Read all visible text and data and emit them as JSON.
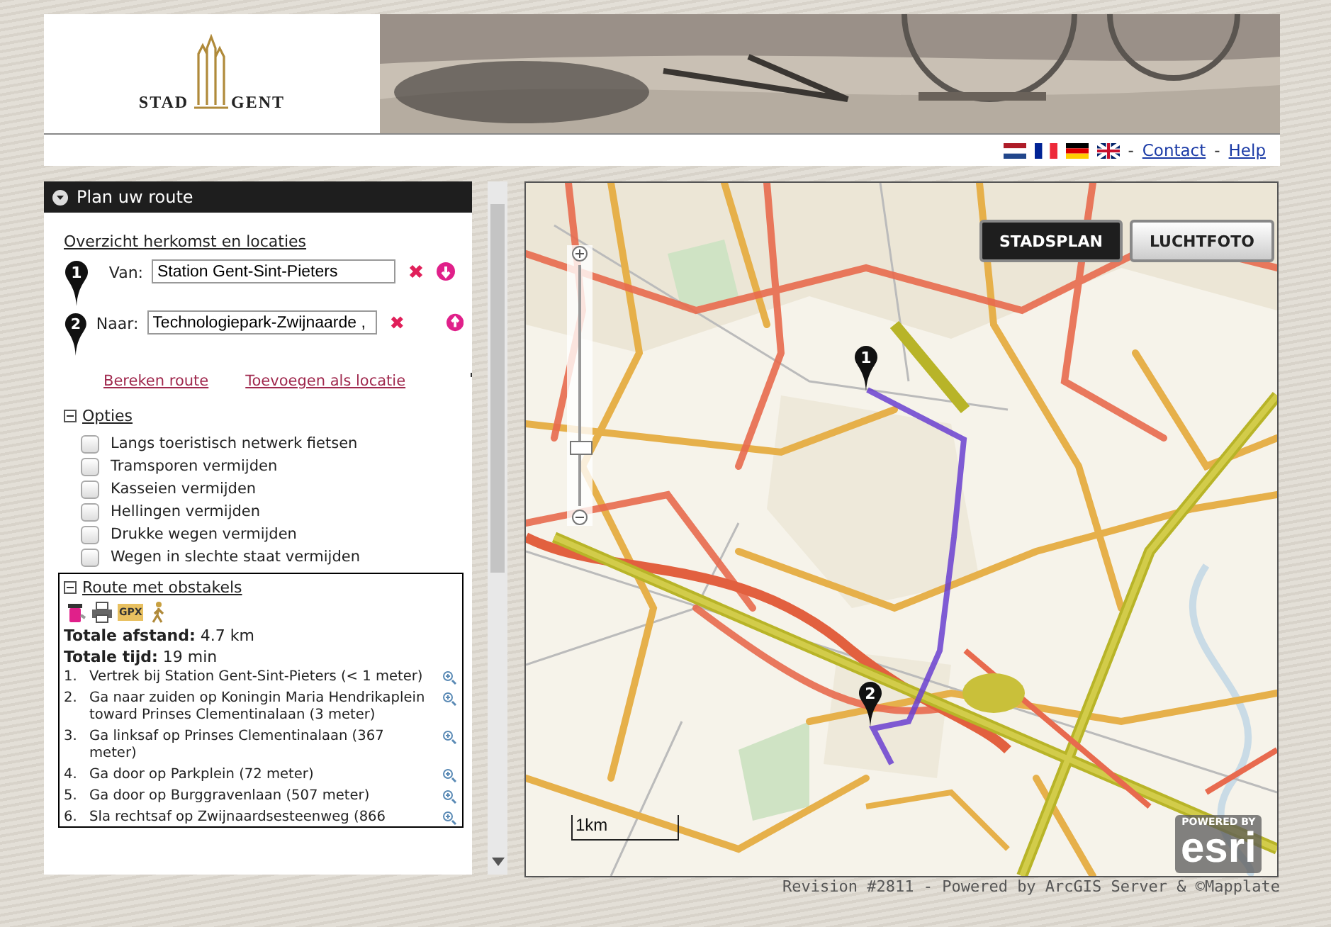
{
  "header": {
    "logo_words": [
      "STAD",
      "GENT"
    ]
  },
  "link_bar": {
    "items": [
      {
        "kind": "separator",
        "text": "-"
      },
      {
        "kind": "link",
        "text": "Contact"
      },
      {
        "kind": "separator",
        "text": "-"
      },
      {
        "kind": "link",
        "text": "Help"
      }
    ]
  },
  "panel": {
    "title": "Plan uw route",
    "expanded": true,
    "overview_link": "Overzicht herkomst en locaties",
    "stops": [
      {
        "number": "1",
        "label": "Van:",
        "value": "Station Gent-Sint-Pieters",
        "move_down": true,
        "move_up": false
      },
      {
        "number": "2",
        "label": "Naar:",
        "value": "Technologiepark-Zwijnaarde ,",
        "move_down": false,
        "move_up": true
      }
    ],
    "actions": [
      "Bereken route",
      "Toevoegen als locatie"
    ],
    "options": {
      "title": "Opties",
      "items": [
        {
          "label": "Langs toeristisch netwerk fietsen",
          "checked": false
        },
        {
          "label": "Tramsporen vermijden",
          "checked": false
        },
        {
          "label": "Kasseien vermijden",
          "checked": false
        },
        {
          "label": "Hellingen vermijden",
          "checked": false
        },
        {
          "label": "Drukke wegen vermijden",
          "checked": false
        },
        {
          "label": "Wegen in slechte staat vermijden",
          "checked": false
        }
      ]
    },
    "route": {
      "title": "Route met obstakels",
      "gpx_label": "GPX",
      "distance_label": "Totale afstand:",
      "distance": "4.7 km",
      "time_label": "Totale tijd:",
      "time": "19 min",
      "steps": [
        {
          "number": "1.",
          "text": "Vertrek bij Station Gent-Sint-Pieters (< 1 meter)"
        },
        {
          "number": "2.",
          "text": "Ga naar zuiden op Koningin Maria Hendrikaplein toward Prinses Clementinalaan (3 meter)"
        },
        {
          "number": "3.",
          "text": "Ga linksaf op Prinses Clementinalaan (367 meter)"
        },
        {
          "number": "4.",
          "text": "Ga door op Parkplein (72 meter)"
        },
        {
          "number": "5.",
          "text": "Ga door op Burggravenlaan (507 meter)"
        },
        {
          "number": "6.",
          "text": "Sla rechtsaf op Zwijnaardsesteenweg (866"
        }
      ]
    }
  },
  "map": {
    "view_buttons": [
      {
        "label": "STADSPLAN",
        "selected": true
      },
      {
        "label": "LUCHTFOTO",
        "selected": false
      }
    ],
    "zoom": {
      "level": 0.24
    },
    "markers": [
      "1",
      "2"
    ],
    "scale": "1km",
    "attribution": {
      "powered": "POWERED BY",
      "brand": "esri"
    }
  },
  "footer": "Revision #2811 - Powered by ArcGIS Server & ©Mapplate"
}
